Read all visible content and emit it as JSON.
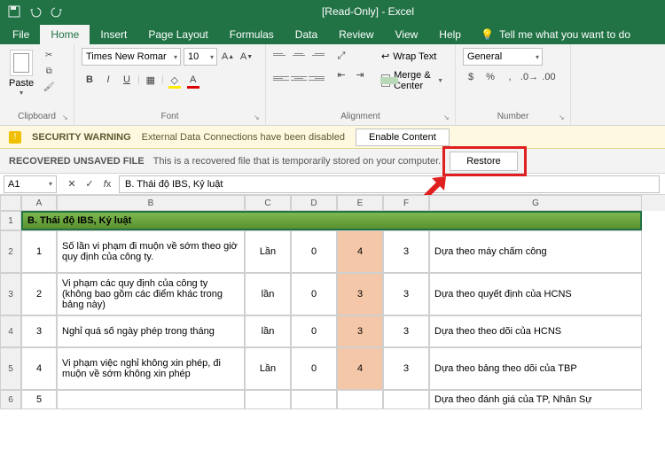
{
  "title": "[Read-Only]  -  Excel",
  "menu": {
    "file": "File",
    "home": "Home",
    "insert": "Insert",
    "pagelayout": "Page Layout",
    "formulas": "Formulas",
    "data": "Data",
    "review": "Review",
    "view": "View",
    "help": "Help",
    "tellme": "Tell me what you want to do"
  },
  "ribbon": {
    "clipboard": {
      "label": "Clipboard",
      "paste": "Paste"
    },
    "font": {
      "label": "Font",
      "name": "Times New Romar",
      "size": "10"
    },
    "alignment": {
      "label": "Alignment",
      "wrap": "Wrap Text",
      "merge": "Merge & Center"
    },
    "number": {
      "label": "Number",
      "format": "General"
    }
  },
  "security": {
    "title": "SECURITY WARNING",
    "msg": "External Data Connections have been disabled",
    "btn": "Enable Content"
  },
  "recover": {
    "title": "RECOVERED UNSAVED FILE",
    "msg": "This is a recovered file that is temporarily stored on your computer.",
    "btn": "Restore"
  },
  "namebox": "A1",
  "formula": "B. Thái độ IBS, Kỷ luật",
  "cols": [
    "A",
    "B",
    "C",
    "D",
    "E",
    "F",
    "G"
  ],
  "row1": {
    "a": "B. Thái độ IBS, Kỷ luật"
  },
  "data": [
    {
      "n": "1",
      "desc": "Số lần vi phạm đi muộn về sớm theo giờ quy định của công ty.",
      "unit": "Lần",
      "d": "0",
      "e": "4",
      "f": "3",
      "g": "Dựa theo máy chấm công"
    },
    {
      "n": "2",
      "desc": "Vi phạm các quy định của công ty (không bao gồm các điểm khác trong bảng này)",
      "unit": "lần",
      "d": "0",
      "e": "3",
      "f": "3",
      "g": "Dựa theo quyết định của HCNS"
    },
    {
      "n": "3",
      "desc": "Nghỉ quá số ngày phép trong tháng",
      "unit": "lần",
      "d": "0",
      "e": "3",
      "f": "3",
      "g": "Dựa theo theo dõi của HCNS"
    },
    {
      "n": "4",
      "desc": "Vi phạm việc nghỉ không xin phép, đi muộn về sớm không xin phép",
      "unit": "Lần",
      "d": "0",
      "e": "4",
      "f": "3",
      "g": "Dựa theo bảng theo dõi của TBP"
    },
    {
      "n": "5",
      "desc": "",
      "unit": "",
      "d": "",
      "e": "",
      "f": "",
      "g": "Dựa theo đánh giá của TP, Nhân Sự"
    }
  ]
}
